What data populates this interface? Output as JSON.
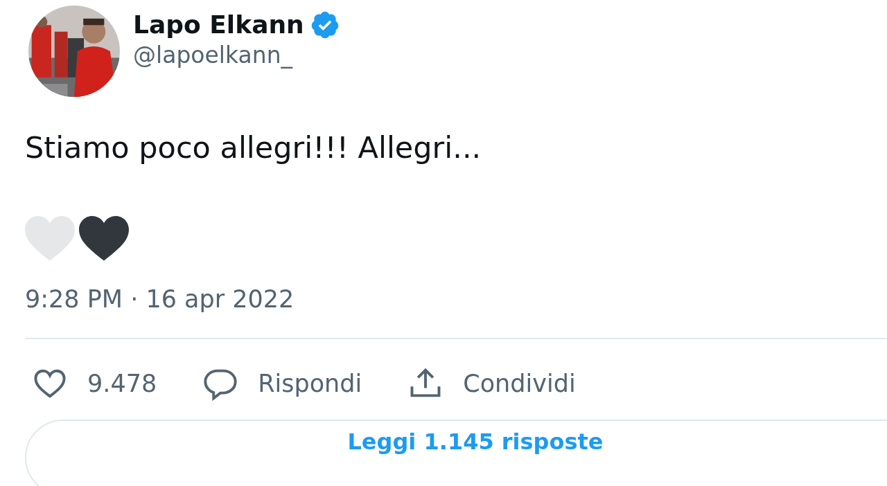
{
  "author": {
    "name": "Lapo Elkann",
    "verified": true,
    "handle": "@lapoelkann_"
  },
  "text": "Stiamo poco allegri!!! Allegri...",
  "timestamp": "9:28 PM · 16 apr 2022",
  "actions": [
    {
      "kind": "like",
      "label": "9.478"
    },
    {
      "kind": "reply",
      "label": "Rispondi"
    },
    {
      "kind": "share",
      "label": "Condividi"
    }
  ],
  "replies_button": "Leggi 1.145 risposte"
}
